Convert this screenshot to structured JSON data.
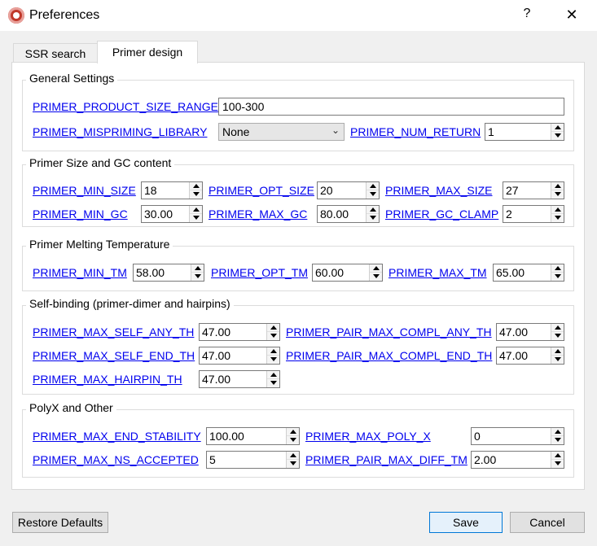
{
  "window": {
    "title": "Preferences",
    "help": "?",
    "close": "✕"
  },
  "tabs": [
    {
      "label": "SSR search"
    },
    {
      "label": "Primer design"
    }
  ],
  "general": {
    "title": "General Settings",
    "product_size_label": "PRIMER_PRODUCT_SIZE_RANGE",
    "product_size_value": "100-300",
    "mispriming_label": "PRIMER_MISPRIMING_LIBRARY",
    "mispriming_value": "None",
    "num_return_label": "PRIMER_NUM_RETURN",
    "num_return_value": "1"
  },
  "size_gc": {
    "title": "Primer Size and GC content",
    "min_size_label": "PRIMER_MIN_SIZE",
    "min_size_value": "18",
    "opt_size_label": "PRIMER_OPT_SIZE",
    "opt_size_value": "20",
    "max_size_label": "PRIMER_MAX_SIZE",
    "max_size_value": "27",
    "min_gc_label": "PRIMER_MIN_GC",
    "min_gc_value": "30.00",
    "max_gc_label": "PRIMER_MAX_GC",
    "max_gc_value": "80.00",
    "gc_clamp_label": "PRIMER_GC_CLAMP",
    "gc_clamp_value": "2"
  },
  "melting": {
    "title": "Primer Melting Temperature",
    "min_tm_label": "PRIMER_MIN_TM",
    "min_tm_value": "58.00",
    "opt_tm_label": "PRIMER_OPT_TM",
    "opt_tm_value": "60.00",
    "max_tm_label": "PRIMER_MAX_TM",
    "max_tm_value": "65.00"
  },
  "self_binding": {
    "title": "Self-binding (primer-dimer and hairpins)",
    "max_self_any_label": "PRIMER_MAX_SELF_ANY_TH",
    "max_self_any_value": "47.00",
    "pair_compl_any_label": "PRIMER_PAIR_MAX_COMPL_ANY_TH",
    "pair_compl_any_value": "47.00",
    "max_self_end_label": "PRIMER_MAX_SELF_END_TH",
    "max_self_end_value": "47.00",
    "pair_compl_end_label": "PRIMER_PAIR_MAX_COMPL_END_TH",
    "pair_compl_end_value": "47.00",
    "hairpin_label": "PRIMER_MAX_HAIRPIN_TH",
    "hairpin_value": "47.00"
  },
  "polyx": {
    "title": "PolyX and Other",
    "end_stability_label": "PRIMER_MAX_END_STABILITY",
    "end_stability_value": "100.00",
    "poly_x_label": "PRIMER_MAX_POLY_X",
    "poly_x_value": "0",
    "ns_accepted_label": "PRIMER_MAX_NS_ACCEPTED",
    "ns_accepted_value": "5",
    "pair_diff_tm_label": "PRIMER_PAIR_MAX_DIFF_TM",
    "pair_diff_tm_value": "2.00"
  },
  "buttons": {
    "restore": "Restore Defaults",
    "save": "Save",
    "cancel": "Cancel"
  }
}
